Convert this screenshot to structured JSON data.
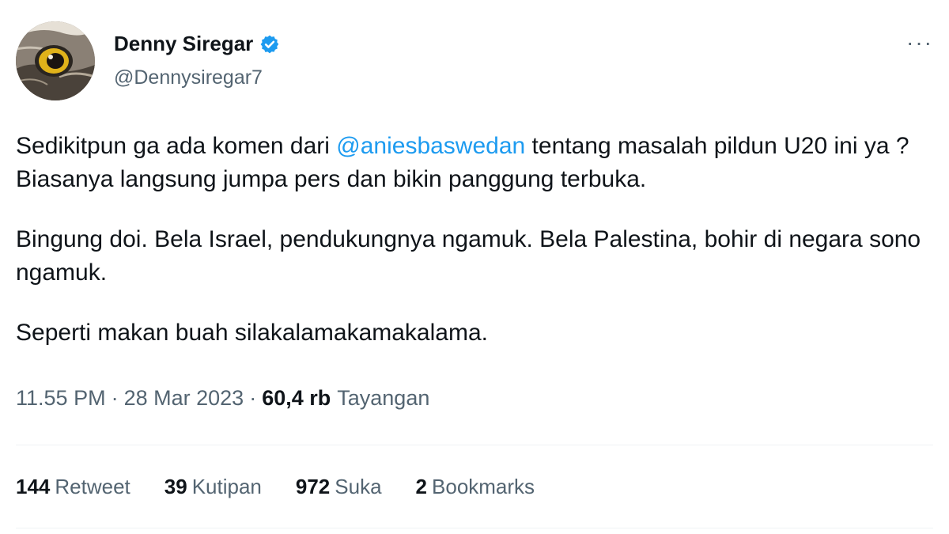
{
  "author": {
    "display_name": "Denny Siregar",
    "handle": "@Dennysiregar7",
    "verified_icon": "verified-badge-icon",
    "accent_color": "#1d9bf0"
  },
  "tweet": {
    "paragraph1_before": "Sedikitpun ga ada komen dari ",
    "mention": "@aniesbaswedan",
    "paragraph1_after": " tentang masalah pildun U20 ini ya ? Biasanya langsung jumpa pers dan bikin panggung terbuka.",
    "paragraph2": "Bingung doi. Bela Israel, pendukungnya ngamuk. Bela Palestina, bohir di negara sono ngamuk.",
    "paragraph3": "Seperti makan buah silakalamakamakalama."
  },
  "meta": {
    "time": "11.55 PM",
    "separator": "·",
    "date": "28 Mar 2023",
    "views_count": "60,4 rb",
    "views_label": "Tayangan"
  },
  "stats": [
    {
      "count": "144",
      "label": "Retweet"
    },
    {
      "count": "39",
      "label": "Kutipan"
    },
    {
      "count": "972",
      "label": "Suka"
    },
    {
      "count": "2",
      "label": "Bookmarks"
    }
  ],
  "more_menu_label": "···"
}
